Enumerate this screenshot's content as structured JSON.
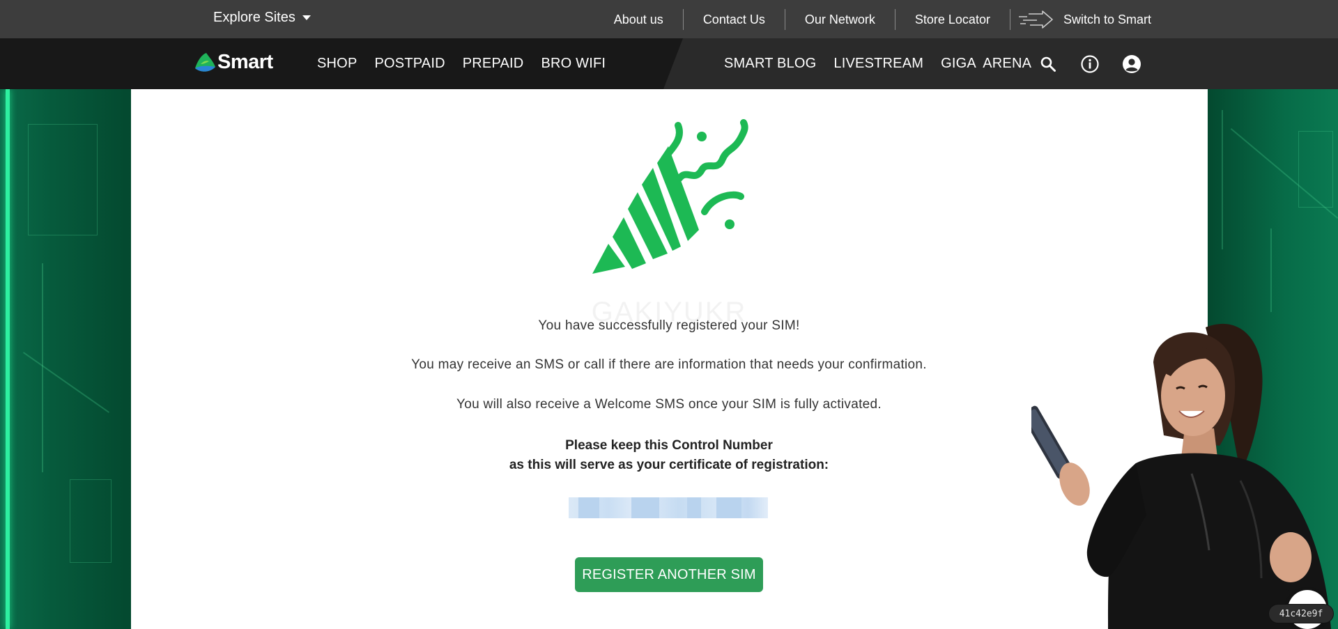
{
  "topbar": {
    "explore_label": "Explore Sites",
    "links": {
      "about": "About us",
      "contact": "Contact Us",
      "network": "Our Network",
      "store": "Store Locator",
      "switch": "Switch to Smart"
    }
  },
  "nav": {
    "logo_text": "Smart",
    "left": {
      "shop": "SHOP",
      "postpaid": "POSTPAID",
      "prepaid": "PREPAID",
      "browifi": "BRO WIFI"
    },
    "right": {
      "blog": "SMART BLOG",
      "livestream": "LIVESTREAM",
      "giga": "GIGA  ARENA"
    },
    "icons": [
      "search-icon",
      "info-icon",
      "account-icon"
    ]
  },
  "main": {
    "watermark": "GAKIYUKR",
    "success_message": "You have successfully registered your SIM!",
    "sms_message": "You may receive an SMS or call if there are information that needs your confirmation.",
    "welcome_message": "You will also receive a Welcome SMS once your SIM is fully activated.",
    "keep_line1": "Please keep this Control Number",
    "keep_line2": "as this will serve as your certificate of registration:",
    "register_button": "REGISTER ANOTHER SIM"
  },
  "overlay": {
    "hash_badge": "41c42e9f"
  },
  "colors": {
    "accent_green": "#2e9d57",
    "popper_green": "#1db954",
    "topbar": "#3d3d3d",
    "navbar": "#2a2a2a"
  }
}
